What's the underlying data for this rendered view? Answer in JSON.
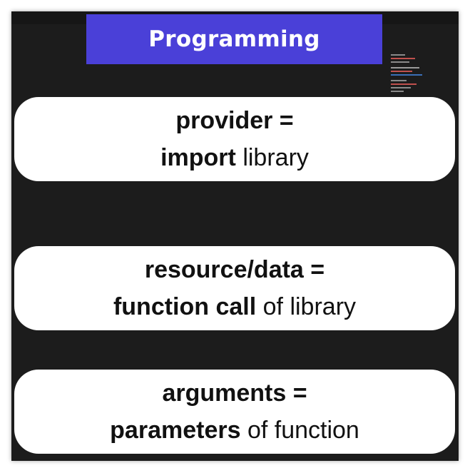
{
  "slide": {
    "title": "Programming",
    "cards": [
      {
        "line1_bold": "provider =",
        "line2_bold": "import",
        "line2_regular": " library"
      },
      {
        "line1_bold": "resource/data =",
        "line2_bold": "function call",
        "line2_regular": " of library"
      },
      {
        "line1_bold": "arguments =",
        "line2_bold": "parameters",
        "line2_regular": " of function"
      }
    ]
  },
  "colors": {
    "background": "#1c1c1c",
    "title_bar": "#4a40d8",
    "card": "#ffffff",
    "text": "#111111"
  }
}
